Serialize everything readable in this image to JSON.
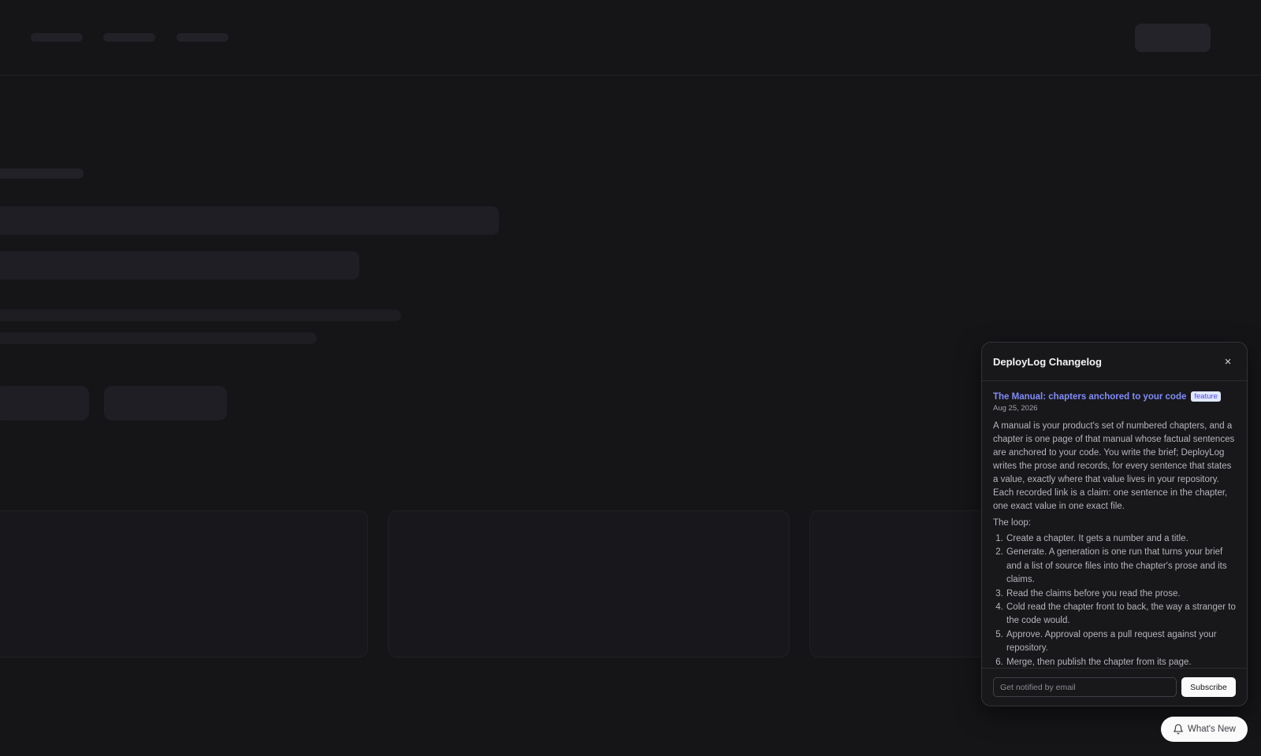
{
  "changelog": {
    "title": "DeployLog Changelog",
    "close_label": "×",
    "entries": [
      {
        "title": "The Manual: chapters anchored to your code",
        "badge": "feature",
        "date": "Aug 25, 2026",
        "body": "A manual is your product's set of numbered chapters, and a chapter is one page of that manual whose factual sentences are anchored to your code. You write the brief; DeployLog writes the prose and records, for every sentence that states a value, exactly where that value lives in your repository. Each recorded link is a claim: one sentence in the chapter, one exact value in one exact file.",
        "loop_label": "The loop:",
        "steps": [
          "Create a chapter. It gets a number and a title.",
          "Generate. A generation is one run that turns your brief and a list of source files into the chapter's prose and its claims.",
          "Read the claims before you read the prose.",
          "Cold read the chapter front to back, the way a stranger to the code would.",
          "Approve. Approval opens a pull request against your repository.",
          "Merge, then publish the chapter from its page."
        ]
      }
    ],
    "subscribe": {
      "placeholder": "Get notified by email",
      "button_label": "Subscribe"
    }
  },
  "launcher": {
    "label": "What's New",
    "icon": "bell-icon"
  }
}
